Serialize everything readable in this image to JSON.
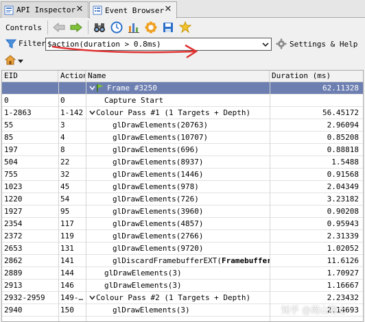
{
  "tabs": [
    {
      "label": "API Inspector",
      "icon": "api-inspector-icon",
      "active": false
    },
    {
      "label": "Event Browser",
      "icon": "event-browser-icon",
      "active": true
    }
  ],
  "toolbar": {
    "label": "Controls",
    "buttons": [
      "back-arrow-icon",
      "forward-arrow-icon",
      "binoculars-icon",
      "clock-icon",
      "bar-chart-icon",
      "gear-flower-icon",
      "save-icon",
      "star-puzzle-icon"
    ]
  },
  "filter": {
    "label": "Filter",
    "value": "$action(duration > 0.8ms)",
    "settings_label": "Settings & Help"
  },
  "table": {
    "columns": [
      "EID",
      "Action",
      "Name",
      "Duration (ms)"
    ],
    "rows": [
      {
        "eid": "",
        "action": "",
        "name": "Frame #3250",
        "duration": "62.11328",
        "level": 0,
        "expander": "v",
        "selected": true,
        "flag": true
      },
      {
        "eid": "0",
        "action": "0",
        "name": "Capture Start",
        "duration": "",
        "level": 1,
        "expander": "",
        "selected": false
      },
      {
        "eid": "1-2863",
        "action": "1-142",
        "name": "Colour Pass #1 (1 Targets + Depth)",
        "duration": "56.45172",
        "level": 0,
        "expander": "v",
        "selected": false
      },
      {
        "eid": "55",
        "action": "3",
        "name": "glDrawElements(20763)",
        "duration": "2.96094",
        "level": 2,
        "expander": "",
        "selected": false
      },
      {
        "eid": "85",
        "action": "4",
        "name": "glDrawElements(10707)",
        "duration": "0.85208",
        "level": 2,
        "expander": "",
        "selected": false
      },
      {
        "eid": "197",
        "action": "8",
        "name": "glDrawElements(696)",
        "duration": "0.88818",
        "level": 2,
        "expander": "",
        "selected": false
      },
      {
        "eid": "504",
        "action": "22",
        "name": "glDrawElements(8937)",
        "duration": "1.5488",
        "level": 2,
        "expander": "",
        "selected": false
      },
      {
        "eid": "755",
        "action": "32",
        "name": "glDrawElements(1446)",
        "duration": "0.91568",
        "level": 2,
        "expander": "",
        "selected": false
      },
      {
        "eid": "1023",
        "action": "45",
        "name": "glDrawElements(978)",
        "duration": "2.04349",
        "level": 2,
        "expander": "",
        "selected": false
      },
      {
        "eid": "1220",
        "action": "54",
        "name": "glDrawElements(726)",
        "duration": "3.23182",
        "level": 2,
        "expander": "",
        "selected": false
      },
      {
        "eid": "1927",
        "action": "95",
        "name": "glDrawElements(3960)",
        "duration": "0.90208",
        "level": 2,
        "expander": "",
        "selected": false
      },
      {
        "eid": "2354",
        "action": "117",
        "name": "glDrawElements(4857)",
        "duration": "0.95943",
        "level": 2,
        "expander": "",
        "selected": false
      },
      {
        "eid": "2372",
        "action": "119",
        "name": "glDrawElements(2766)",
        "duration": "2.31339",
        "level": 2,
        "expander": "",
        "selected": false
      },
      {
        "eid": "2653",
        "action": "131",
        "name": "glDrawElements(9720)",
        "duration": "1.02052",
        "level": 2,
        "expander": "",
        "selected": false
      },
      {
        "eid": "2862",
        "action": "141",
        "name": "glDiscardFramebufferEXT(",
        "name_bold": "Framebuffer",
        "duration": "11.6126",
        "level": 2,
        "expander": "",
        "selected": false
      },
      {
        "eid": "2889",
        "action": "144",
        "name": "glDrawElements(3)",
        "duration": "1.70927",
        "level": 1,
        "expander": "",
        "selected": false
      },
      {
        "eid": "2913",
        "action": "146",
        "name": "glDrawElements(3)",
        "duration": "1.16667",
        "level": 1,
        "expander": "",
        "selected": false
      },
      {
        "eid": "2932-2959",
        "action": "149-…",
        "name": "Colour Pass #2 (1 Targets + Depth)",
        "duration": "2.23432",
        "level": 0,
        "expander": "v",
        "selected": false
      },
      {
        "eid": "2940",
        "action": "150",
        "name": "glDrawElements(3)",
        "duration": "2.14693",
        "level": 2,
        "expander": "",
        "selected": false
      }
    ]
  },
  "watermark": "知乎 @南山隐士",
  "colors": {
    "selection": "#6d7fb1",
    "annotation_arrow": "#e03030"
  }
}
